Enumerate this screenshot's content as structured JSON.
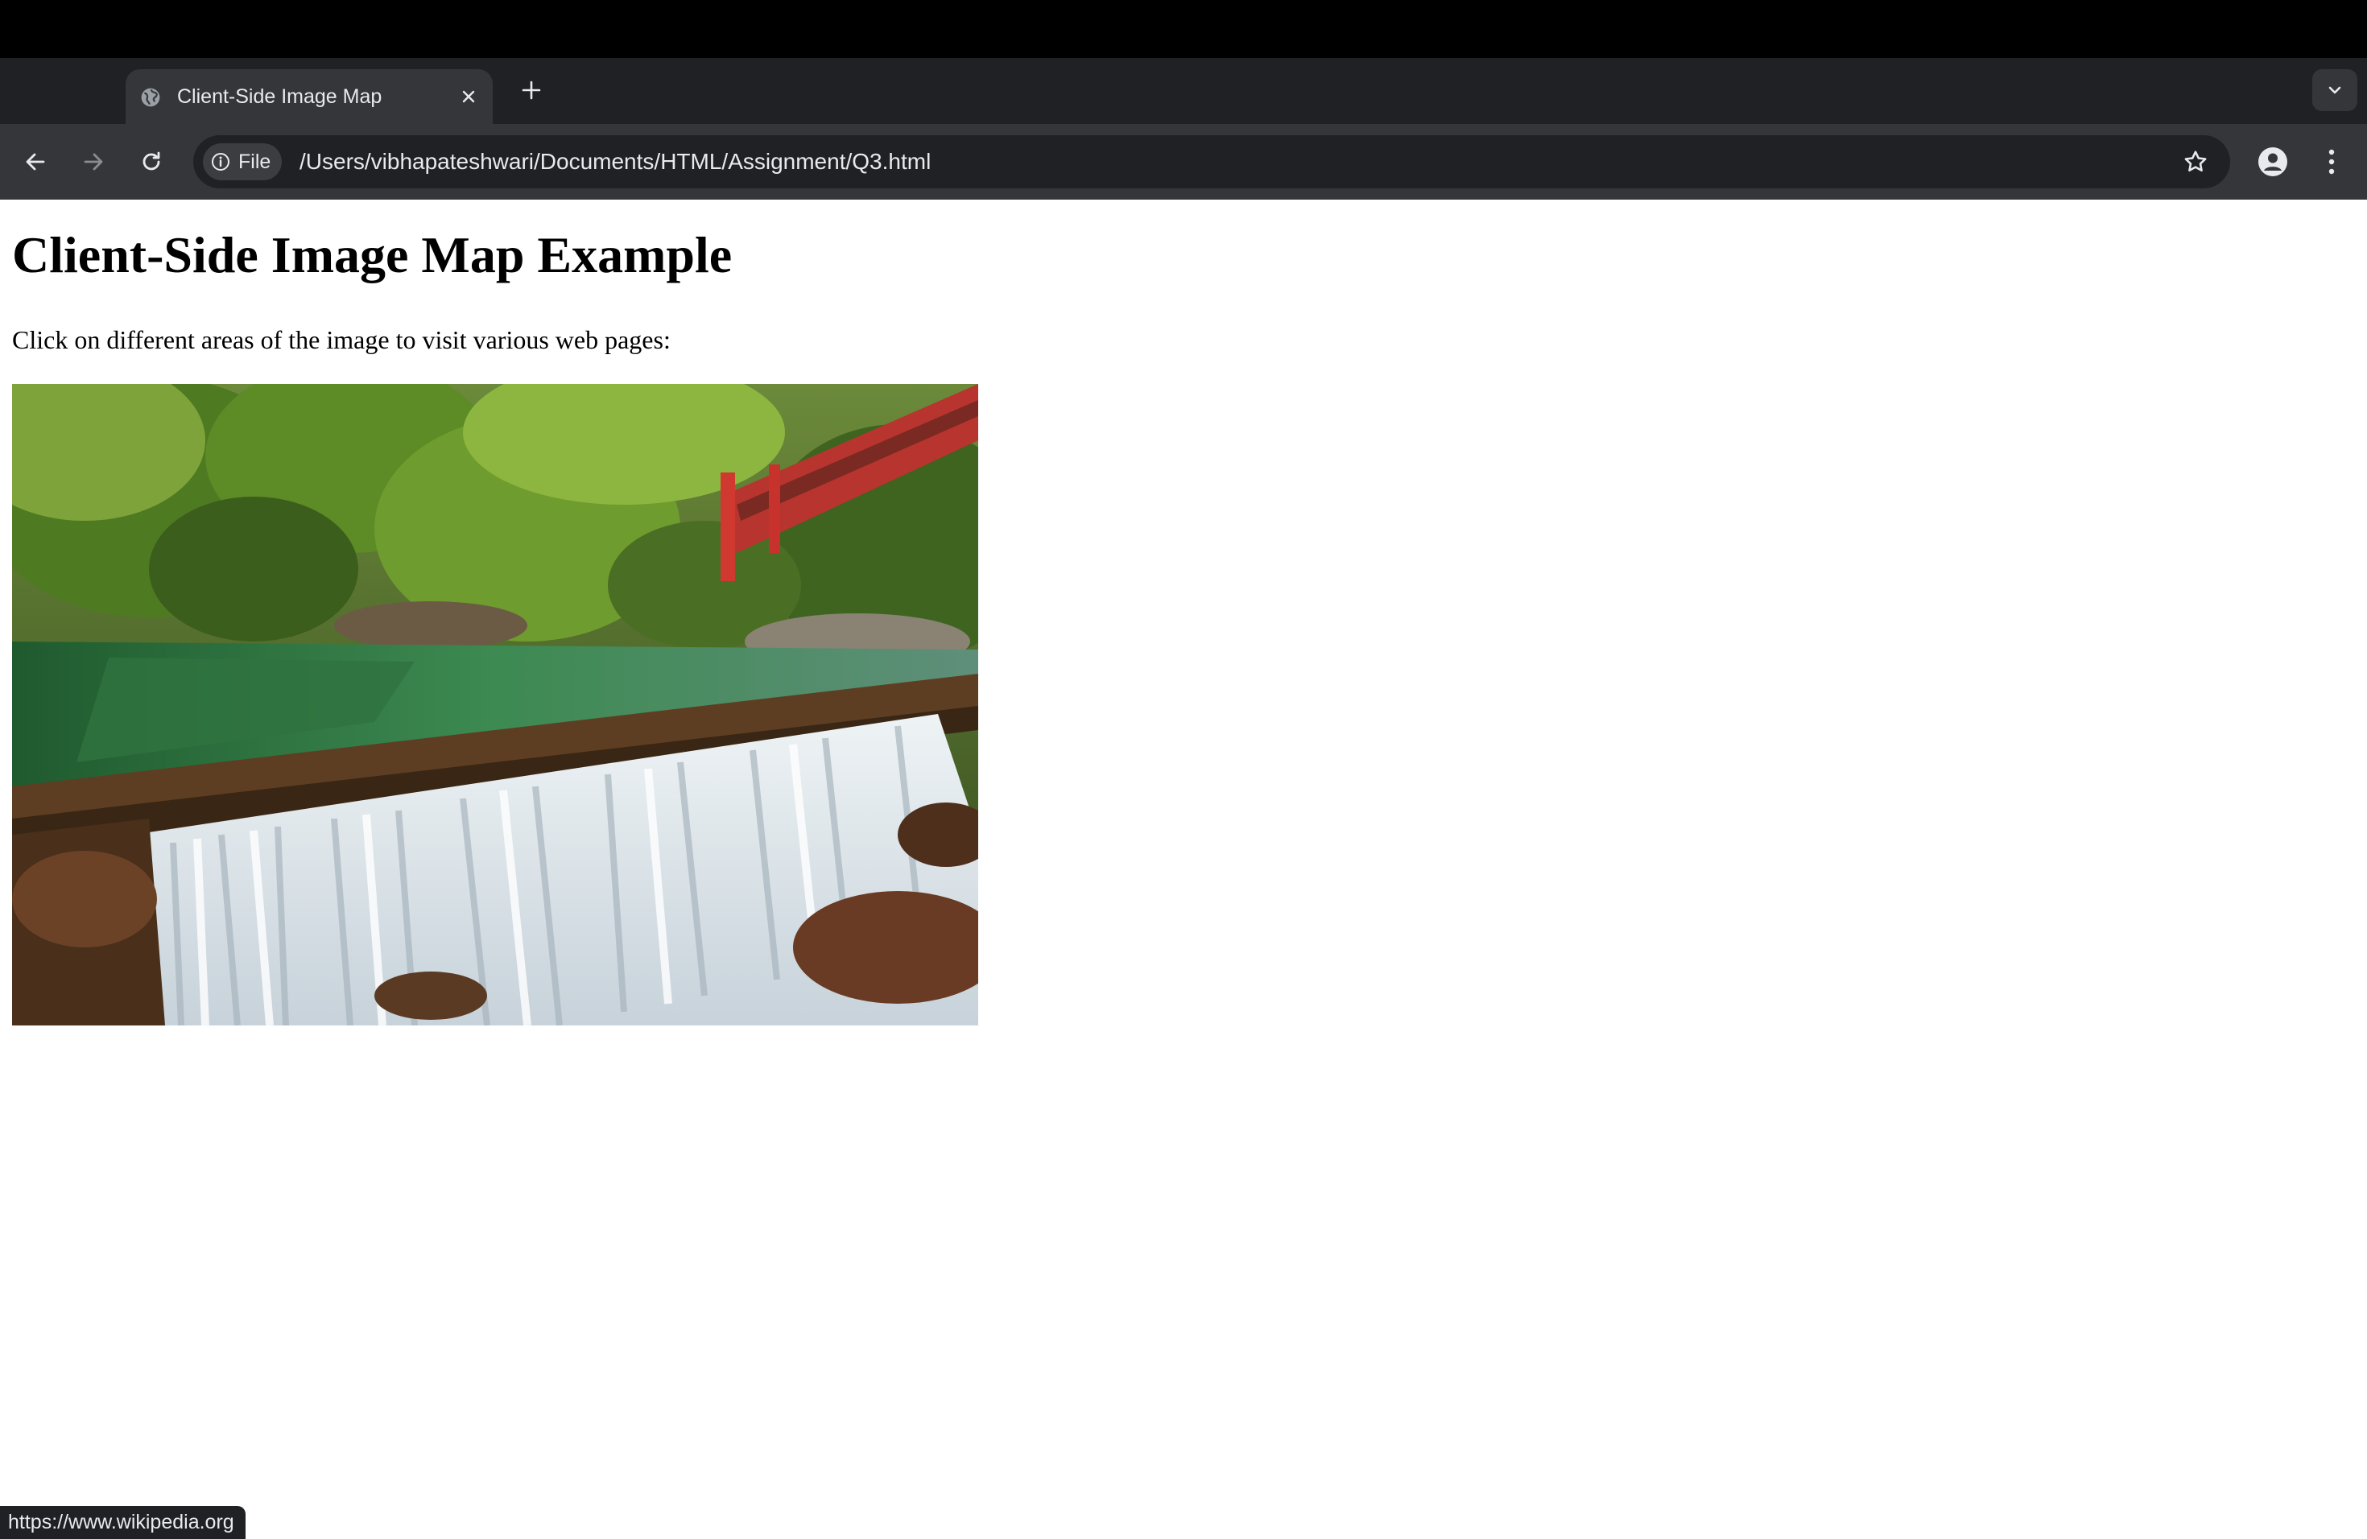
{
  "browser": {
    "tab": {
      "title": "Client-Side Image Map"
    },
    "site_chip_label": "File",
    "url": "/Users/vibhapateshwari/Documents/HTML/Assignment/Q3.html",
    "status_url": "https://www.wikipedia.org",
    "icons": [
      "globe-icon",
      "close-icon",
      "plus-icon",
      "chevron-down-icon",
      "back-arrow-icon",
      "forward-arrow-icon",
      "reload-icon",
      "info-icon",
      "star-icon",
      "profile-icon",
      "kebab-menu-icon"
    ]
  },
  "page": {
    "heading": "Client-Side Image Map Example",
    "instruction": "Click on different areas of the image to visit various web pages:",
    "image": {
      "subject": "waterfall with green pool and red footbridge"
    }
  },
  "colors": {
    "tabstrip": "#202124",
    "toolbar": "#35363a",
    "text_light": "#e8eaed",
    "bridge_red": "#c8322c"
  }
}
